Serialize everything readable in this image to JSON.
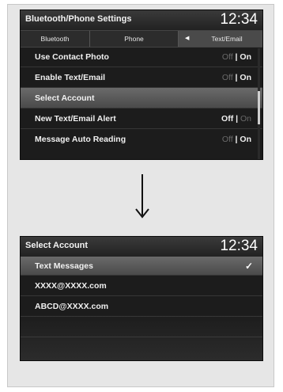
{
  "screen1": {
    "title": "Bluetooth/Phone Settings",
    "clock": "12:34",
    "tabs": [
      {
        "label": "Bluetooth"
      },
      {
        "label": "Phone"
      },
      {
        "label": "Text/Email",
        "active": true
      }
    ],
    "rows": [
      {
        "label": "Use Contact Photo",
        "off": "Off",
        "sep": " | ",
        "on": "On",
        "selected_value": "On"
      },
      {
        "label": "Enable Text/Email",
        "off": "Off",
        "sep": " | ",
        "on": "On",
        "selected_value": "On"
      },
      {
        "label": "Select Account",
        "highlighted": true
      },
      {
        "label": "New Text/Email Alert",
        "off": "Off",
        "sep": " | ",
        "on": "On",
        "selected_value": "Off"
      },
      {
        "label": "Message Auto Reading",
        "off": "Off",
        "sep": " | ",
        "on": "On",
        "selected_value": "On"
      }
    ],
    "scroll_position": 0.55
  },
  "arrow_icon": "down-arrow-icon",
  "screen2": {
    "title": "Select Account",
    "clock": "12:34",
    "rows": [
      {
        "label": "Text Messages",
        "checked": true,
        "check_icon": "checkmark-icon"
      },
      {
        "label": "XXXX@XXXX.com"
      },
      {
        "label": "ABCD@XXXX.com"
      }
    ]
  },
  "colors": {
    "screen_bg": "#1c1c1c",
    "highlight": "#5a5a5a",
    "text": "#f0f0f0",
    "dim_text": "#6a6a6a"
  }
}
